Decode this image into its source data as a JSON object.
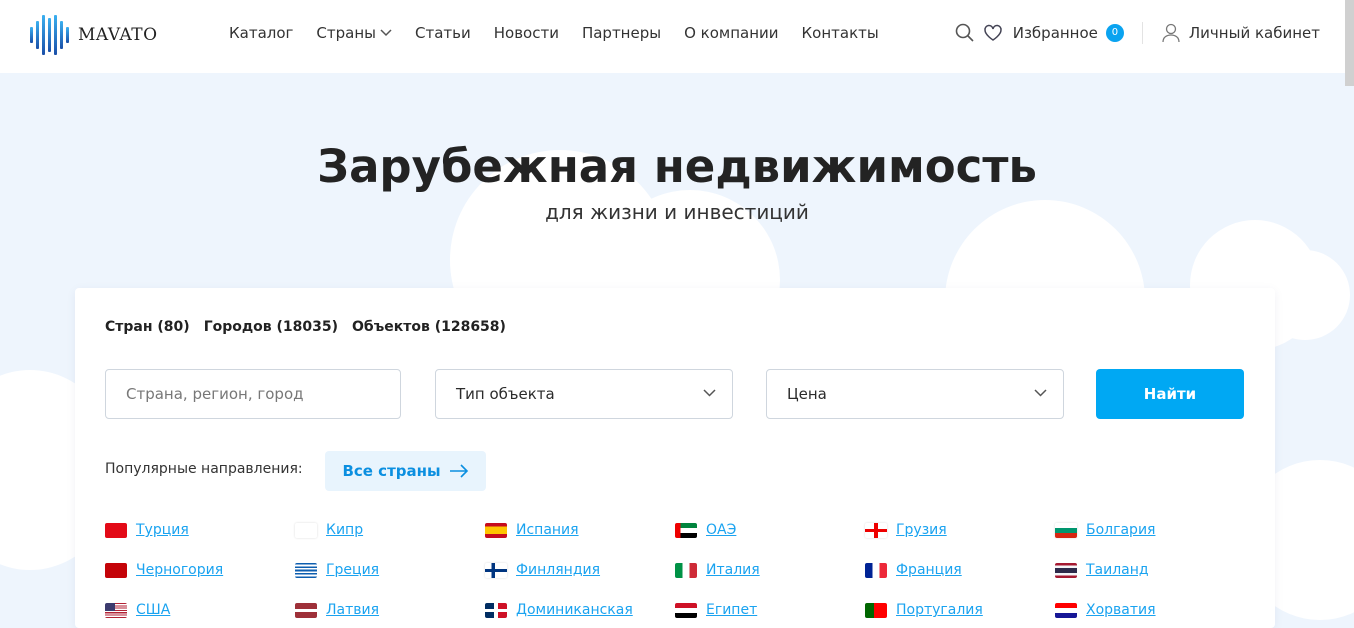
{
  "header": {
    "logo": "MAVATO",
    "nav": [
      "Каталог",
      "Страны",
      "Статьи",
      "Новости",
      "Партнеры",
      "О компании",
      "Контакты"
    ],
    "favorites_label": "Избранное",
    "favorites_count": "0",
    "account_label": "Личный кабинет"
  },
  "hero": {
    "title": "Зарубежная недвижимость",
    "subtitle": "для жизни и инвестиций"
  },
  "search": {
    "stats": [
      "Стран (80)",
      "Городов (18035)",
      "Объектов (128658)"
    ],
    "location_placeholder": "Страна, регион, город",
    "type_select": "Тип объекта",
    "price_select": "Цена",
    "find_label": "Найти",
    "popular_label": "Популярные направления:",
    "all_countries_label": "Все страны"
  },
  "countries": [
    {
      "name": "Турция",
      "flag": "tr"
    },
    {
      "name": "Кипр",
      "flag": "cy"
    },
    {
      "name": "Испания",
      "flag": "es"
    },
    {
      "name": "ОАЭ",
      "flag": "ae"
    },
    {
      "name": "Грузия",
      "flag": "ge"
    },
    {
      "name": "Болгария",
      "flag": "bg"
    },
    {
      "name": "Черногория",
      "flag": "me"
    },
    {
      "name": "Греция",
      "flag": "gr"
    },
    {
      "name": "Финляндия",
      "flag": "fi"
    },
    {
      "name": "Италия",
      "flag": "it"
    },
    {
      "name": "Франция",
      "flag": "fr"
    },
    {
      "name": "Таиланд",
      "flag": "th"
    },
    {
      "name": "США",
      "flag": "us"
    },
    {
      "name": "Латвия",
      "flag": "lv"
    },
    {
      "name": "Доминиканская",
      "flag": "do"
    },
    {
      "name": "Египет",
      "flag": "eg"
    },
    {
      "name": "Португалия",
      "flag": "pt"
    },
    {
      "name": "Хорватия",
      "flag": "hr"
    }
  ],
  "colors": {
    "accent": "#00a8f3",
    "link": "#1aa3f0",
    "background": "#eef5fd"
  }
}
